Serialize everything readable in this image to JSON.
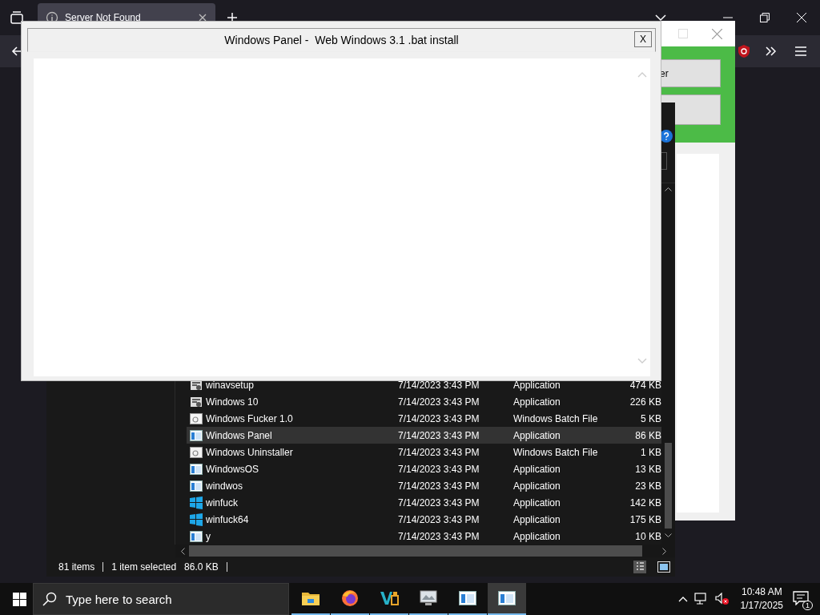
{
  "browser": {
    "tabs": [
      {
        "title": "Server Not Found",
        "selected": true
      }
    ]
  },
  "side_window": {
    "buttons": [
      {
        "label": "er"
      }
    ]
  },
  "explorer": {
    "rows": [
      {
        "name": "winavsetup",
        "date": "7/14/2023 3:43 PM",
        "type": "Application",
        "size": "474 KB",
        "kind": "setup",
        "selected": false
      },
      {
        "name": "Windows 10",
        "date": "7/14/2023 3:43 PM",
        "type": "Application",
        "size": "226 KB",
        "kind": "setup",
        "selected": false
      },
      {
        "name": "Windows Fucker 1.0",
        "date": "7/14/2023 3:43 PM",
        "type": "Windows Batch File",
        "size": "5 KB",
        "kind": "batch",
        "selected": false
      },
      {
        "name": "Windows Panel",
        "date": "7/14/2023 3:43 PM",
        "type": "Application",
        "size": "86 KB",
        "kind": "app",
        "selected": true
      },
      {
        "name": "Windows Uninstaller",
        "date": "7/14/2023 3:43 PM",
        "type": "Windows Batch File",
        "size": "1 KB",
        "kind": "batch",
        "selected": false
      },
      {
        "name": "WindowsOS",
        "date": "7/14/2023 3:43 PM",
        "type": "Application",
        "size": "13 KB",
        "kind": "app",
        "selected": false
      },
      {
        "name": "windwos",
        "date": "7/14/2023 3:43 PM",
        "type": "Application",
        "size": "23 KB",
        "kind": "app",
        "selected": false
      },
      {
        "name": "winfuck",
        "date": "7/14/2023 3:43 PM",
        "type": "Application",
        "size": "142 KB",
        "kind": "logo",
        "selected": false
      },
      {
        "name": "winfuck64",
        "date": "7/14/2023 3:43 PM",
        "type": "Application",
        "size": "175 KB",
        "kind": "logo",
        "selected": false
      },
      {
        "name": "y",
        "date": "7/14/2023 3:43 PM",
        "type": "Application",
        "size": "10 KB",
        "kind": "app",
        "selected": false
      }
    ],
    "status": {
      "count": "81 items",
      "selection": "1 item selected",
      "size": "86.0 KB"
    }
  },
  "dialog": {
    "title": "Windows Panel -  Web Windows 3.1 .bat install",
    "close": "X"
  },
  "taskbar": {
    "search_placeholder": "Type here to search",
    "apps": [
      {
        "kind": "folder",
        "selected": false
      },
      {
        "kind": "firefox",
        "selected": false
      },
      {
        "kind": "vs",
        "selected": false
      },
      {
        "kind": "photo",
        "selected": false
      },
      {
        "kind": "app",
        "selected": false
      },
      {
        "kind": "app",
        "selected": true
      }
    ],
    "time": "10:48 AM",
    "date": "1/17/2025",
    "notifications": "1"
  }
}
